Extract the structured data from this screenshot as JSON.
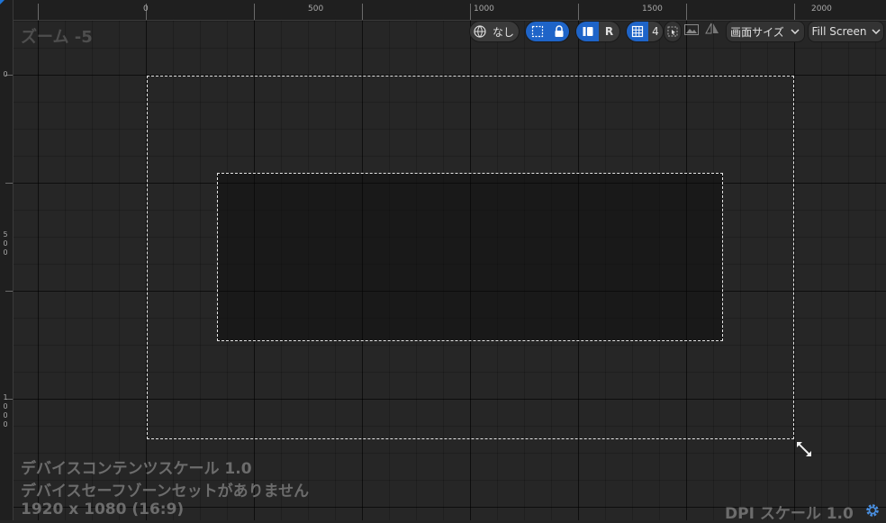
{
  "ruler": {
    "top_labels": [
      "0",
      "500",
      "1000",
      "1500",
      "2000"
    ],
    "left_labels": [
      "0",
      "5\n0\n0",
      "1\n0\n0\n0"
    ]
  },
  "zoom_label": "ズーム -5",
  "toolbar": {
    "world_icon": "globe-icon",
    "locale_label": "なし",
    "safe_zone_icon": "dotted-square-icon",
    "lock_icon": "lock-icon",
    "respect_icon": "layout-icon",
    "reset_label": "R",
    "grid_icon": "grid-icon",
    "grid_value": "4",
    "select_icon": "cursor-select-icon",
    "background_icon": "image-icon",
    "flip_icon": "flip-icon",
    "screen_size_label": "画面サイズ",
    "fill_label": "Fill Screen"
  },
  "info": {
    "content_scale": "デバイスコンテンツスケール 1.0",
    "safe_zone": "デバイスセーフゾーンセットがありません",
    "resolution": "1920 x 1080 (16:9)",
    "dpi_scale": "DPI スケール 1.0"
  },
  "colors": {
    "accent": "#1e64c8",
    "background": "#262626",
    "dashed_border": "#e6e6e6"
  }
}
